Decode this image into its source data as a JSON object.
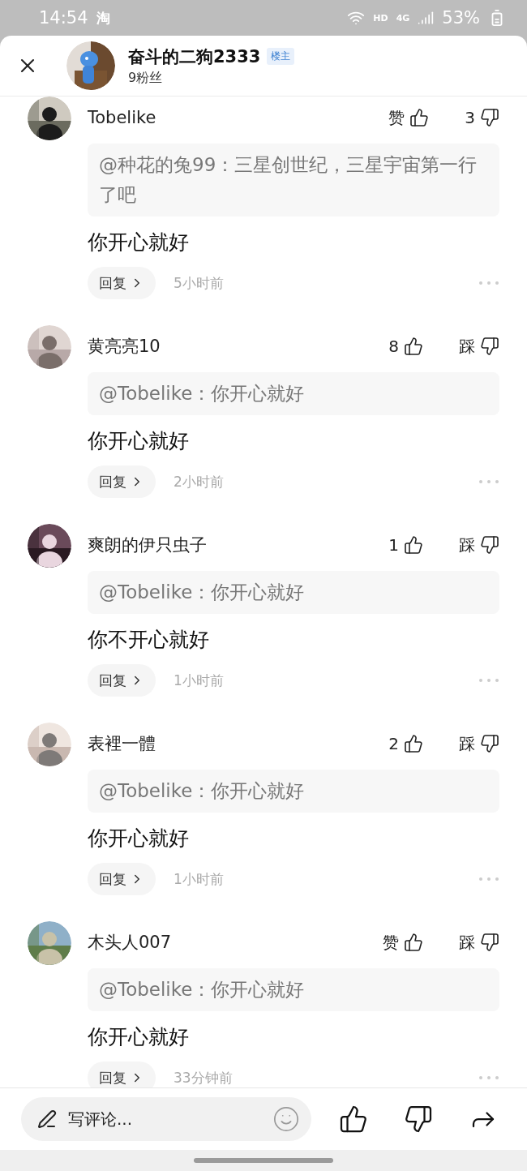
{
  "status_bar": {
    "time": "14:54",
    "app_glyph": "淘",
    "network_hd": "HD",
    "network_type": "4G",
    "battery": "53%"
  },
  "header": {
    "author": "奋斗的二狗2333",
    "badge": "楼主",
    "followers": "9粉丝"
  },
  "comments": [
    {
      "name": "Tobelike",
      "like": "赞",
      "dislike": "3",
      "quote": "@种花的兔99：三星创世纪，三星宇宙第一行了吧",
      "text": "你开心就好",
      "reply": "回复",
      "time": "5小时前"
    },
    {
      "name": "黄亮亮10",
      "like": "8",
      "dislike": "踩",
      "quote": "@Tobelike：你开心就好",
      "text": "你开心就好",
      "reply": "回复",
      "time": "2小时前"
    },
    {
      "name": "爽朗的伊只虫子",
      "like": "1",
      "dislike": "踩",
      "quote": "@Tobelike：你开心就好",
      "text": "你不开心就好",
      "reply": "回复",
      "time": "1小时前"
    },
    {
      "name": "表裡一體",
      "like": "2",
      "dislike": "踩",
      "quote": "@Tobelike：你开心就好",
      "text": "你开心就好",
      "reply": "回复",
      "time": "1小时前"
    },
    {
      "name": "木头人007",
      "like": "赞",
      "dislike": "踩",
      "quote": "@Tobelike：你开心就好",
      "text": "你开心就好",
      "reply": "回复",
      "time": "33分钟前"
    }
  ],
  "composer": {
    "placeholder": "写评论..."
  }
}
